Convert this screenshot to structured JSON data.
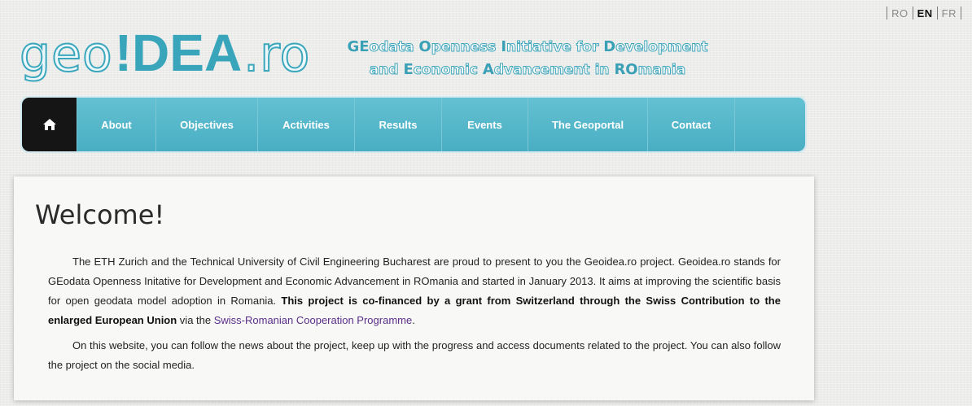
{
  "languages": [
    {
      "label": "RO",
      "active": false
    },
    {
      "label": "EN",
      "active": true
    },
    {
      "label": "FR",
      "active": false
    }
  ],
  "logo": {
    "geo": "geo",
    "idea": "!DEA",
    "dot_ro": ".ro"
  },
  "tagline": {
    "line1": [
      {
        "t": "GE",
        "hl": true
      },
      {
        "t": "odata ",
        "hl": false
      },
      {
        "t": "O",
        "hl": true
      },
      {
        "t": "penness ",
        "hl": false
      },
      {
        "t": "I",
        "hl": true
      },
      {
        "t": "nitiative for ",
        "hl": false
      },
      {
        "t": "D",
        "hl": true
      },
      {
        "t": "evelopment",
        "hl": false
      }
    ],
    "line2": [
      {
        "t": "and ",
        "hl": false
      },
      {
        "t": "E",
        "hl": true
      },
      {
        "t": "conomic ",
        "hl": false
      },
      {
        "t": "A",
        "hl": true
      },
      {
        "t": "dvancement in ",
        "hl": false
      },
      {
        "t": "RO",
        "hl": true
      },
      {
        "t": "mania",
        "hl": false
      }
    ]
  },
  "nav": {
    "home_icon": "home-icon",
    "items": [
      "About",
      "Objectives",
      "Activities",
      "Results",
      "Events",
      "The Geoportal",
      "Contact"
    ]
  },
  "content": {
    "heading": "Welcome!",
    "p1_a": "The ETH Zurich and the Technical University of Civil Engineering Bucharest are proud to present to you the Geoidea.ro project. Geoidea.ro stands for GEodata Openness Initative for Development and Economic Advancement in ROmania and started in January 2013. It aims at improving the scientific basis for open geodata model adoption in Romania. ",
    "p1_bold": "This project is co-financed by a grant from Switzerland through the Swiss Contribution to the enlarged European Union",
    "p1_b": " via the ",
    "p1_link": "Swiss-Romanian Cooperation Programme",
    "p1_end": ".",
    "p2": "On this website, you can follow the news about the project, keep up with the progress and access documents related to the project. You can also follow the project on the social media."
  }
}
